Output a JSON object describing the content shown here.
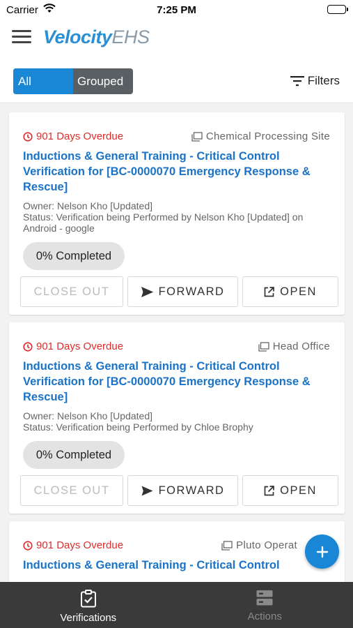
{
  "status_bar": {
    "carrier": "Carrier",
    "time": "7:25 PM"
  },
  "header": {
    "logo_primary": "Velocity",
    "logo_secondary": "EHS"
  },
  "view_toggle": {
    "all_label": "All",
    "grouped_label": "Grouped",
    "selected": "All"
  },
  "filters_label": "Filters",
  "cards": [
    {
      "overdue": "901 Days Overdue",
      "site": "Chemical Processing Site",
      "title": "Inductions & General Training - Critical Control Verification for [BC-0000070 Emergency Response & Rescue]",
      "owner": "Owner: Nelson Kho [Updated]",
      "status": "Status: Verification being Performed by Nelson Kho [Updated] on Android - google",
      "progress": "0% Completed",
      "close_label": "CLOSE OUT",
      "forward_label": "FORWARD",
      "open_label": "OPEN"
    },
    {
      "overdue": "901 Days Overdue",
      "site": "Head Office",
      "title": "Inductions & General Training - Critical Control Verification for [BC-0000070 Emergency Response & Rescue]",
      "owner": "Owner: Nelson Kho [Updated]",
      "status": "Status: Verification being Performed by Chloe Brophy",
      "progress": "0% Completed",
      "close_label": "CLOSE OUT",
      "forward_label": "FORWARD",
      "open_label": "OPEN"
    },
    {
      "overdue": "901 Days Overdue",
      "site": "Pluto Operat",
      "title": "Inductions & General Training - Critical Control"
    }
  ],
  "tabs": [
    {
      "label": "Verifications",
      "icon": "clipboard-check-icon",
      "active": true
    },
    {
      "label": "Actions",
      "icon": "server-icon",
      "active": false
    }
  ],
  "colors": {
    "accent": "#1a86d6",
    "overdue": "#e02b2b",
    "title": "#1a73c7",
    "tabbar": "#3a3a3a"
  }
}
